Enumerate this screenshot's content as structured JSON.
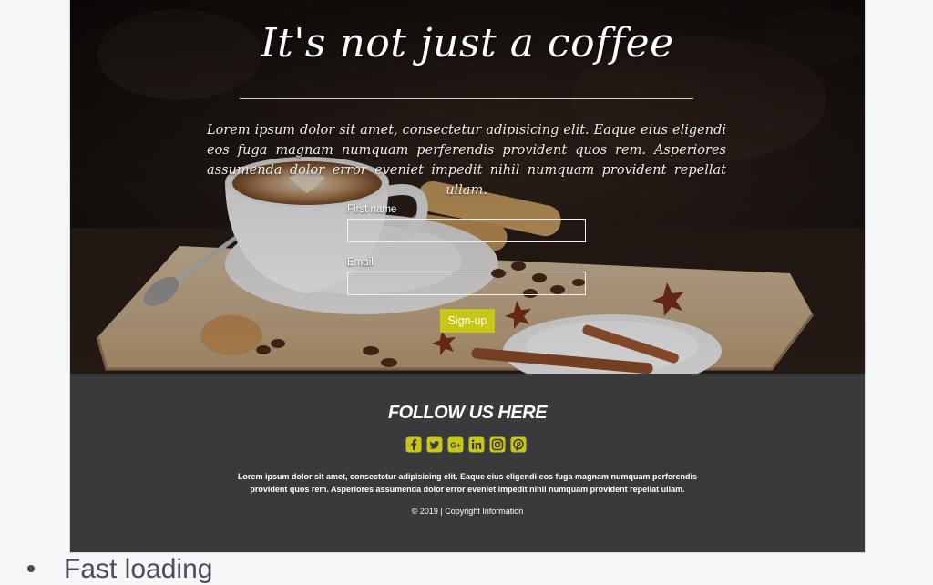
{
  "hero": {
    "title": "It's not just a coffee",
    "text": "Lorem ipsum dolor sit amet, consectetur adipisicing elit. Eaque eius eligendi eos fuga magnam numquam perferendis provident quos rem. Asperiores assumenda dolor error eveniet impedit nihil numquam provident repellat ullam."
  },
  "form": {
    "first_name_label": "First name",
    "first_name_value": "",
    "email_label": "Email",
    "email_value": "",
    "submit_label": "Sign-up"
  },
  "footer": {
    "title": "FOLLOW US HERE",
    "socials": [
      "facebook-icon",
      "twitter-icon",
      "google-plus-icon",
      "linkedin-icon",
      "instagram-icon",
      "pinterest-icon"
    ],
    "text": "Lorem ipsum dolor sit amet, consectetur adipisicing elit. Eaque eius eligendi eos fuga magnam numquam perferendis provident quos rem. Asperiores assumenda dolor error eveniet impedit nihil numquam provident repellat ullam.",
    "copyright": "© 2019 | Copyright Information"
  },
  "below": {
    "list_item": "Fast loading"
  },
  "colors": {
    "accent": "#c8c617",
    "footer_bg": "#3a3a3c",
    "page_bg": "#f5f6f8"
  }
}
